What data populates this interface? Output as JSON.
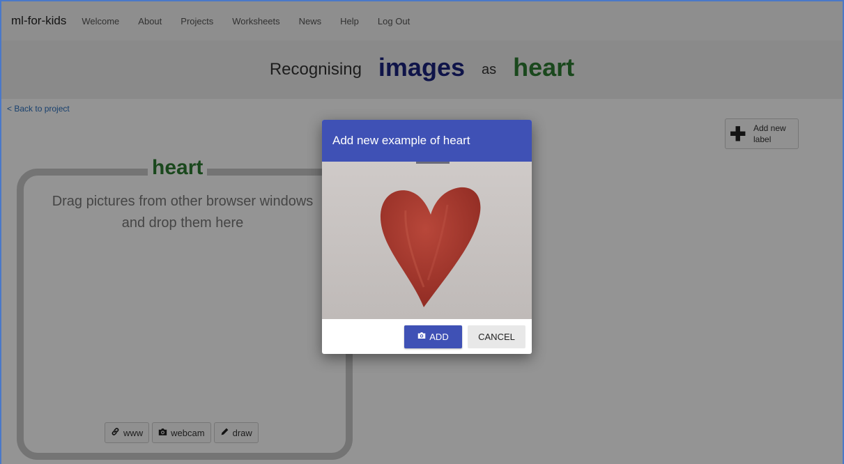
{
  "nav": {
    "brand": "ml-for-kids",
    "links": [
      "Welcome",
      "About",
      "Projects",
      "Worksheets",
      "News",
      "Help",
      "Log Out"
    ]
  },
  "title": {
    "prefix": "Recognising",
    "type": "images",
    "as": "as",
    "label": "heart"
  },
  "back_link": "< Back to project",
  "add_label_button": "Add new label",
  "bucket": {
    "title": "heart",
    "drop_line1": "Drag pictures from other browser windows",
    "drop_line2": "and drop them here",
    "buttons": {
      "www": {
        "label": "www",
        "icon": "link-icon"
      },
      "webcam": {
        "label": "webcam",
        "icon": "camera-icon"
      },
      "draw": {
        "label": "draw",
        "icon": "pencil-icon"
      }
    }
  },
  "modal": {
    "title": "Add new example of heart",
    "image": "webcam-capture-red-heart",
    "add_button": "ADD",
    "cancel_button": "CANCEL"
  },
  "colors": {
    "header_blue": "#3f51b5",
    "title_type": "#1a237e",
    "label_green": "#2e7d32",
    "heart_red": "#a5352a"
  }
}
